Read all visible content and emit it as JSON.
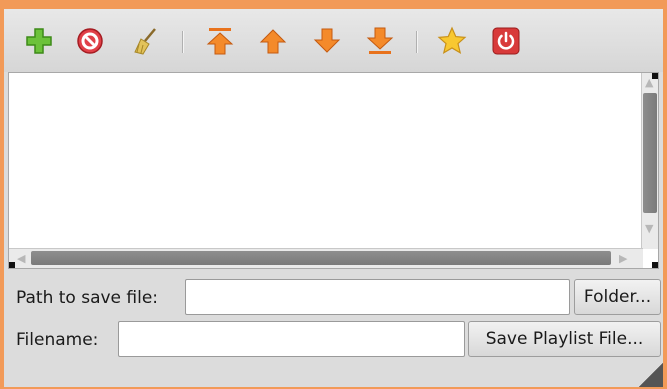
{
  "toolbar": {
    "items": [
      {
        "name": "add-icon",
        "color": "#5cb82a"
      },
      {
        "name": "stop-icon",
        "color": "#d7333a"
      },
      {
        "name": "broom-icon",
        "color": "#c8a23a"
      },
      {
        "name": "move-to-top-icon",
        "color": "#f07c20"
      },
      {
        "name": "move-up-icon",
        "color": "#f07c20"
      },
      {
        "name": "move-down-icon",
        "color": "#f07c20"
      },
      {
        "name": "move-to-bottom-icon",
        "color": "#f07c20"
      },
      {
        "name": "star-icon",
        "color": "#f6c22a"
      },
      {
        "name": "power-icon",
        "color": "#d83a3a"
      }
    ]
  },
  "form": {
    "path_label": "Path to save file:",
    "path_value": "",
    "folder_button": "Folder...",
    "filename_label": "Filename:",
    "filename_value": "",
    "save_button": "Save Playlist File..."
  },
  "colors": {
    "frame": "#f29a58",
    "window_bg": "#dcdcdc",
    "scroll_thumb": "#858585"
  }
}
